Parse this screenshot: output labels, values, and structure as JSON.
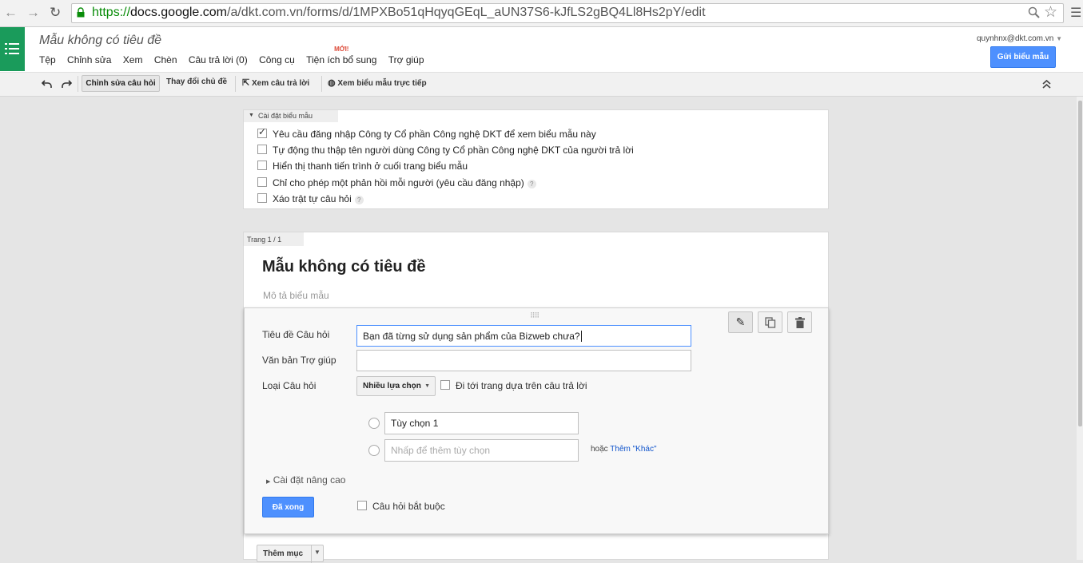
{
  "browser": {
    "url_scheme": "https://",
    "url_host": "docs.google.com",
    "url_path": "/a/dkt.com.vn/forms/d/1MPXBo51qHqyqGEqL_aUN37S6-kJfLS2gBQ4Ll8Hs2pY/edit"
  },
  "header": {
    "doc_title": "Mẫu không có tiêu đề",
    "account": "quynhnx@dkt.com.vn",
    "send_button": "Gửi biểu mẫu",
    "menu": [
      "Tệp",
      "Chỉnh sửa",
      "Xem",
      "Chèn",
      "Câu trả lời (0)",
      "Công cụ",
      "Tiện ích bổ sung",
      "Trợ giúp"
    ],
    "new_badge": "MỚI!"
  },
  "toolbar": {
    "edit_questions": "Chỉnh sửa câu hỏi",
    "change_theme": "Thay đổi chủ đề",
    "view_responses": "Xem câu trả lời",
    "view_live_form": "Xem biểu mẫu trực tiếp"
  },
  "settings": {
    "tab_label": "Cài đặt biểu mẫu",
    "options": [
      {
        "label": "Yêu cầu đăng nhập Công ty Cổ phần Công nghệ DKT để xem biểu mẫu này",
        "checked": true
      },
      {
        "label": "Tự động thu thập tên người dùng Công ty Cổ phần Công nghệ DKT của người trả lời",
        "checked": false
      },
      {
        "label": "Hiển thị thanh tiến trình ở cuối trang biểu mẫu",
        "checked": false
      },
      {
        "label": "Chỉ cho phép một phản hồi mỗi người (yêu cầu đăng nhập)",
        "checked": false
      },
      {
        "label": "Xáo trật tự câu hỏi",
        "checked": false
      }
    ],
    "help_glyph": "?"
  },
  "page": {
    "tab_label": "Trang 1 / 1",
    "form_title": "Mẫu không có tiêu đề",
    "form_description_placeholder": "Mô tả biểu mẫu"
  },
  "question": {
    "title_label": "Tiêu đề Câu hỏi",
    "title_value": "Bạn đã từng sử dụng sản phẩm của Bizweb chưa?",
    "help_label": "Văn bản Trợ giúp",
    "help_value": "",
    "type_label": "Loại Câu hỏi",
    "type_value": "Nhiều lựa chọn",
    "goto_page_label": "Đi tới trang dựa trên câu trả lời",
    "option_1": "Tùy chọn 1",
    "add_option_placeholder": "Nhấp để thêm tùy chọn",
    "or_text": "hoặc",
    "add_other": "Thêm \"Khác\"",
    "advanced_settings": "Cài đặt nâng cao",
    "done_button": "Đã xong",
    "required_label": "Câu hỏi bắt buộc"
  },
  "add_item": {
    "label": "Thêm mục"
  }
}
